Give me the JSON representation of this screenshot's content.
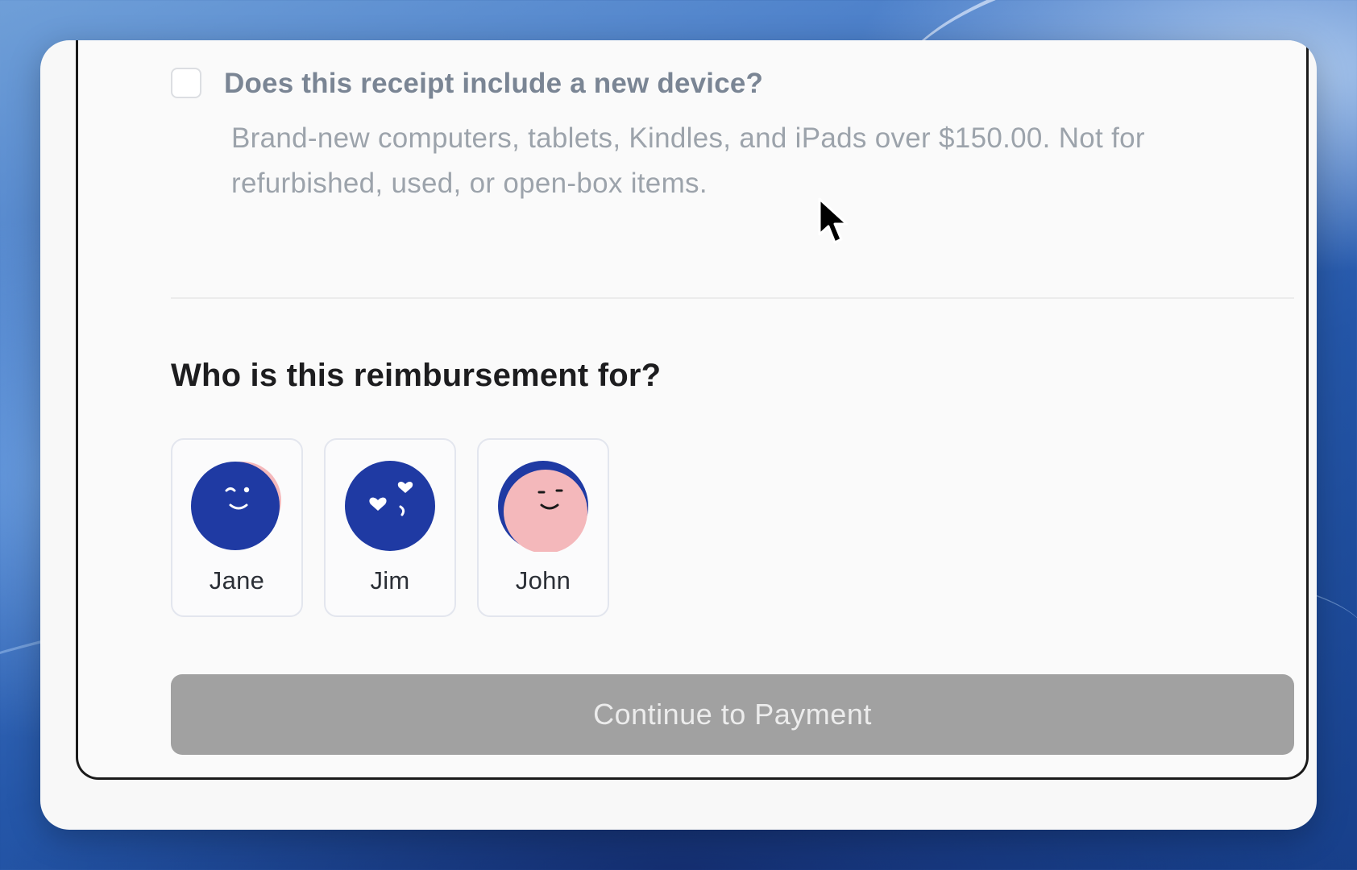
{
  "device_question": {
    "checked": false,
    "label": "Does this receipt include a new device?",
    "help_text": "Brand-new computers, tablets, Kindles, and iPads over $150.00. Not for refurbished, used, or open-box items."
  },
  "recipient": {
    "title": "Who is this reimbursement for?",
    "people": [
      {
        "name": "Jane",
        "avatar": "wink-face-icon"
      },
      {
        "name": "Jim",
        "avatar": "heart-eyes-face-icon"
      },
      {
        "name": "John",
        "avatar": "smile-face-icon"
      }
    ]
  },
  "actions": {
    "continue_label": "Continue to Payment",
    "continue_enabled": false
  },
  "colors": {
    "avatar_blue": "#1f3aa3",
    "avatar_pink": "#f4b8bb",
    "button_disabled": "#a1a1a1"
  }
}
